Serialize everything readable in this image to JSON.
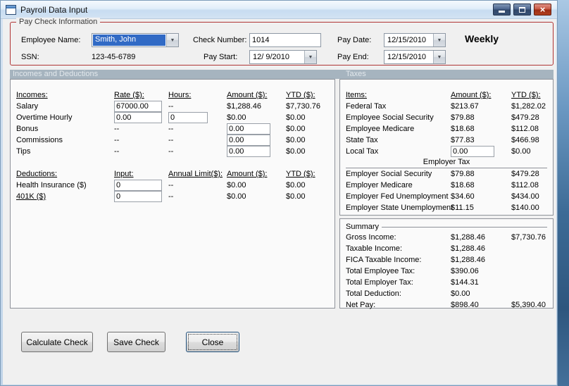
{
  "window": {
    "title": "Payroll Data Input"
  },
  "icons": {
    "dropdown": "▼",
    "close": "×"
  },
  "paycheck_info": {
    "legend": "Pay Check Information",
    "employee_name": {
      "label": "Employee Name:",
      "value": "Smith, John"
    },
    "ssn": {
      "label": "SSN:",
      "value": "123-45-6789"
    },
    "check_number": {
      "label": "Check Number:",
      "value": "1014"
    },
    "pay_start": {
      "label": "Pay Start:",
      "value": "12/ 9/2010"
    },
    "pay_date": {
      "label": "Pay Date:",
      "value": "12/15/2010"
    },
    "pay_end": {
      "label": "Pay End:",
      "value": "12/15/2010"
    },
    "frequency": "Weekly"
  },
  "sections": {
    "incomes_and_deductions": "Incomes and Deductions",
    "taxes": "Taxes"
  },
  "incomes": {
    "headers": {
      "name": "Incomes:",
      "rate": "Rate ($):",
      "hours": "Hours:",
      "amount": "Amount ($):",
      "ytd": "YTD ($):"
    },
    "salary": {
      "label": "Salary",
      "rate": "67000.00",
      "hours": "--",
      "amount": "$1,288.46",
      "ytd": "$7,730.76"
    },
    "overtime": {
      "label": "Overtime Hourly",
      "rate": "0.00",
      "hours": "0",
      "amount": "$0.00",
      "ytd": "$0.00"
    },
    "bonus": {
      "label": "Bonus",
      "rate": "--",
      "hours": "--",
      "amount": "0.00",
      "ytd": "$0.00"
    },
    "commissions": {
      "label": "Commissions",
      "rate": "--",
      "hours": "--",
      "amount": "0.00",
      "ytd": "$0.00"
    },
    "tips": {
      "label": "Tips",
      "rate": "--",
      "hours": "--",
      "amount": "0.00",
      "ytd": "$0.00"
    }
  },
  "deductions": {
    "headers": {
      "name": "Deductions:",
      "input": "Input:",
      "limit": "Annual Limit($):",
      "amount": "Amount ($):",
      "ytd": "YTD ($):"
    },
    "health_insurance": {
      "label": "Health Insurance  ($)",
      "input": "0",
      "limit": "--",
      "amount": "$0.00",
      "ytd": "$0.00"
    },
    "k401": {
      "label": "401K  ($)",
      "input": "0",
      "limit": "--",
      "amount": "$0.00",
      "ytd": "$0.00"
    }
  },
  "taxes": {
    "headers": {
      "items": "Items:",
      "amount": "Amount ($):",
      "ytd": "YTD ($):"
    },
    "employee_rows": [
      {
        "label": "Federal Tax",
        "amount": "$213.67",
        "ytd": "$1,282.02"
      },
      {
        "label": "Employee Social Security",
        "amount": "$79.88",
        "ytd": "$479.28"
      },
      {
        "label": "Employee Medicare",
        "amount": "$18.68",
        "ytd": "$112.08"
      },
      {
        "label": "State Tax",
        "amount": "$77.83",
        "ytd": "$466.98"
      }
    ],
    "local_tax": {
      "label": "Local Tax",
      "input": "0.00",
      "ytd": "$0.00"
    },
    "employer_header": "Employer Tax",
    "employer_rows": [
      {
        "label": "Employer Social Security",
        "amount": "$79.88",
        "ytd": "$479.28"
      },
      {
        "label": "Employer Medicare",
        "amount": "$18.68",
        "ytd": "$112.08"
      },
      {
        "label": "Employer Fed Unemployment",
        "amount": "$34.60",
        "ytd": "$434.00"
      },
      {
        "label": "Employer State Unemployment",
        "amount": "$11.15",
        "ytd": "$140.00"
      }
    ]
  },
  "summary": {
    "legend": "Summary",
    "rows": [
      {
        "label": "Gross Income:",
        "amount": "$1,288.46",
        "ytd": "$7,730.76"
      },
      {
        "label": "Taxable Income:",
        "amount": "$1,288.46",
        "ytd": ""
      },
      {
        "label": "FICA Taxable Income:",
        "amount": "$1,288.46",
        "ytd": ""
      },
      {
        "label": "Total Employee Tax:",
        "amount": "$390.06",
        "ytd": ""
      },
      {
        "label": "Total Employer Tax:",
        "amount": "$144.31",
        "ytd": ""
      },
      {
        "label": "Total Deduction:",
        "amount": "$0.00",
        "ytd": ""
      },
      {
        "label": "Net Pay:",
        "amount": "$898.40",
        "ytd": "$5,390.40"
      }
    ]
  },
  "buttons": {
    "calculate": "Calculate Check",
    "save": "Save Check",
    "close": "Close"
  },
  "colors": {
    "section_bar_bg": "#a6b4bf",
    "group_border": "#b03434",
    "combo_selection": "#316ac5"
  }
}
